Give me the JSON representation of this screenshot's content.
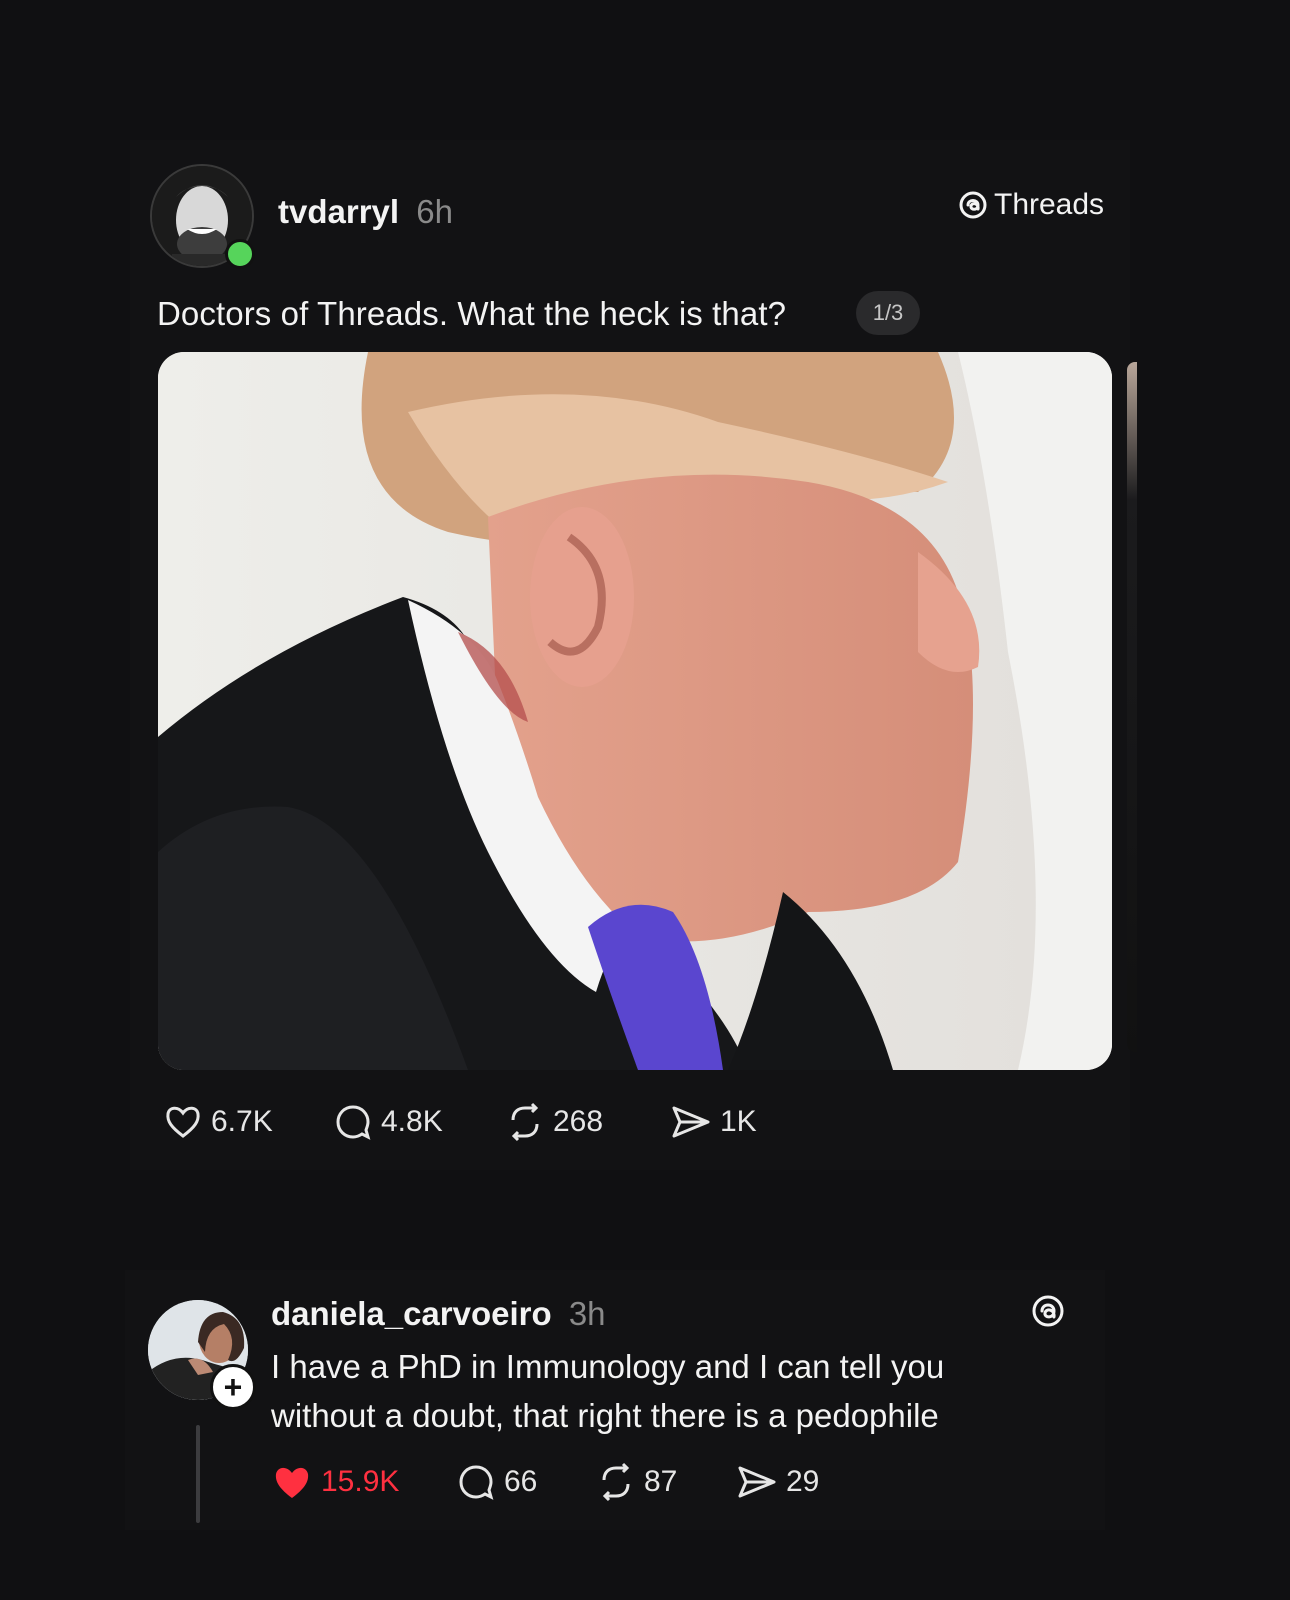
{
  "post": {
    "username": "tvdarryl",
    "time": "6h",
    "brand_label": "Threads",
    "text": "Doctors of Threads. What the heck is that?",
    "media_counter": "1/3",
    "stats": {
      "likes": "6.7K",
      "comments": "4.8K",
      "reposts": "268",
      "shares": "1K"
    }
  },
  "reply": {
    "username": "daniela_carvoeiro",
    "time": "3h",
    "text": "I have a PhD in Immunology and I can tell you without a doubt, that right there is a pedophile",
    "stats": {
      "likes": "15.9K",
      "comments": "66",
      "reposts": "87",
      "shares": "29"
    }
  },
  "colors": {
    "background": "#101012",
    "text": "#f3f3f3",
    "muted": "#8a8a8a",
    "online": "#56d45b",
    "liked": "#ff3040"
  },
  "icons": [
    "heart-icon",
    "comment-icon",
    "repost-icon",
    "share-icon",
    "threads-logo-icon"
  ]
}
